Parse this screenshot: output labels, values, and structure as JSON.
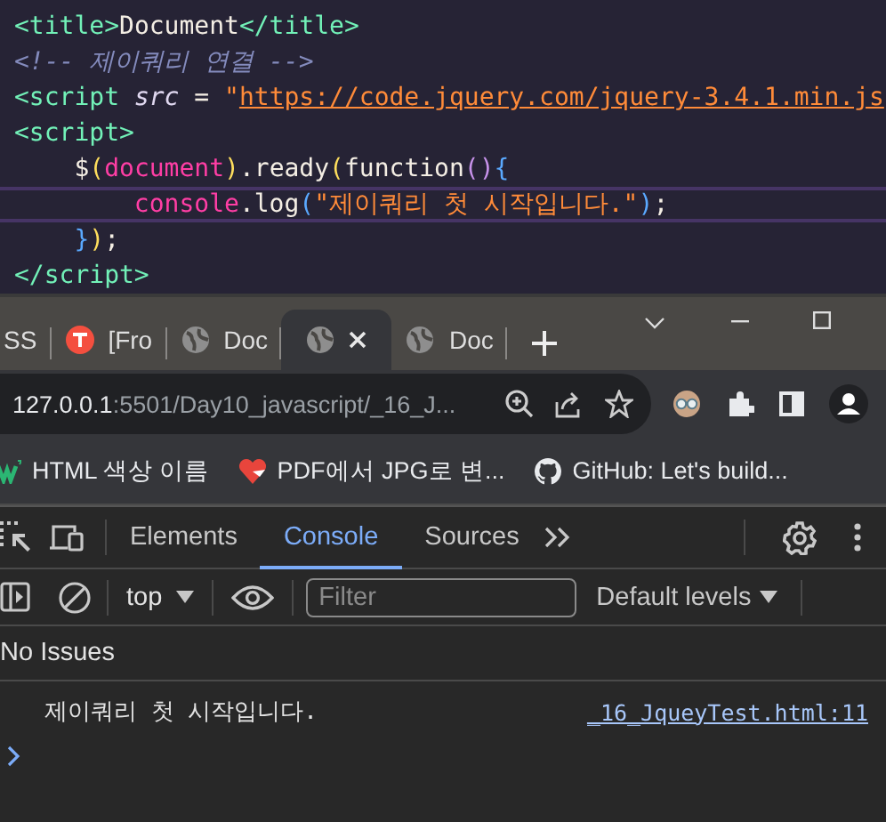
{
  "editor": {
    "lines": [
      {
        "current": false,
        "tokens": [
          {
            "kind": "tag",
            "text": "<title>"
          },
          {
            "kind": "text",
            "text": "Document"
          },
          {
            "kind": "tag",
            "text": "</title>"
          }
        ]
      },
      {
        "current": false,
        "tokens": [
          {
            "kind": "comment",
            "text": "<!-- 제이쿼리 연결 -->"
          }
        ]
      },
      {
        "current": false,
        "tokens": [
          {
            "kind": "tag",
            "text": "<script"
          },
          {
            "kind": "attr",
            "text": " src"
          },
          {
            "kind": "text",
            "text": " = "
          },
          {
            "kind": "string",
            "text": "\""
          },
          {
            "kind": "link",
            "text": "https://code.jquery.com/jquery-3.4.1.min.js"
          }
        ]
      },
      {
        "current": false,
        "tokens": [
          {
            "kind": "tag",
            "text": "<script>"
          }
        ]
      },
      {
        "current": false,
        "tokens": [
          {
            "kind": "text",
            "text": "    $"
          },
          {
            "kind": "yellow",
            "text": "("
          },
          {
            "kind": "pink",
            "text": "document"
          },
          {
            "kind": "yellow",
            "text": ")"
          },
          {
            "kind": "text",
            "text": ".ready"
          },
          {
            "kind": "yellow",
            "text": "("
          },
          {
            "kind": "text",
            "text": "function"
          },
          {
            "kind": "purple",
            "text": "()"
          },
          {
            "kind": "blue",
            "text": "{"
          }
        ]
      },
      {
        "current": true,
        "tokens": [
          {
            "kind": "pink",
            "text": "        console"
          },
          {
            "kind": "text",
            "text": ".log"
          },
          {
            "kind": "blue",
            "text": "("
          },
          {
            "kind": "string",
            "text": "\"제이쿼리 첫 시작입니다.\""
          },
          {
            "kind": "blue",
            "text": ")"
          },
          {
            "kind": "text",
            "text": ";"
          }
        ]
      },
      {
        "current": false,
        "tokens": [
          {
            "kind": "blue",
            "text": "    }"
          },
          {
            "kind": "yellow",
            "text": ")"
          },
          {
            "kind": "text",
            "text": ";"
          }
        ]
      },
      {
        "current": false,
        "tokens": [
          {
            "kind": "tag",
            "text": "</script>"
          }
        ]
      }
    ]
  },
  "browser": {
    "tabs": [
      {
        "title": "SS",
        "kind": "plain",
        "selected": false
      },
      {
        "title": "[Fro",
        "kind": "logo",
        "selected": false
      },
      {
        "title": "Doc",
        "kind": "page",
        "selected": false
      },
      {
        "kind": "page",
        "selected": true
      },
      {
        "title": "Doc",
        "kind": "page",
        "selected": false
      }
    ],
    "address": {
      "host": "127.0.0.1",
      "path": ":5501/Day10_javascript/_16_J..."
    },
    "bookmarks": [
      {
        "label": "HTML 색상 이름"
      },
      {
        "label": "PDF에서 JPG로 변..."
      },
      {
        "label": "GitHub: Let's build..."
      }
    ]
  },
  "devtools": {
    "tabs": [
      {
        "label": "Elements",
        "selected": false
      },
      {
        "label": "Console",
        "selected": true
      },
      {
        "label": "Sources",
        "selected": false
      }
    ],
    "context": "top",
    "filter": {
      "placeholder": "Filter"
    },
    "levels": "Default levels",
    "issues": "No Issues",
    "messages": [
      {
        "text": "제이쿼리 첫 시작입니다.",
        "source": "_16_JqueyTest.html:11"
      }
    ]
  }
}
